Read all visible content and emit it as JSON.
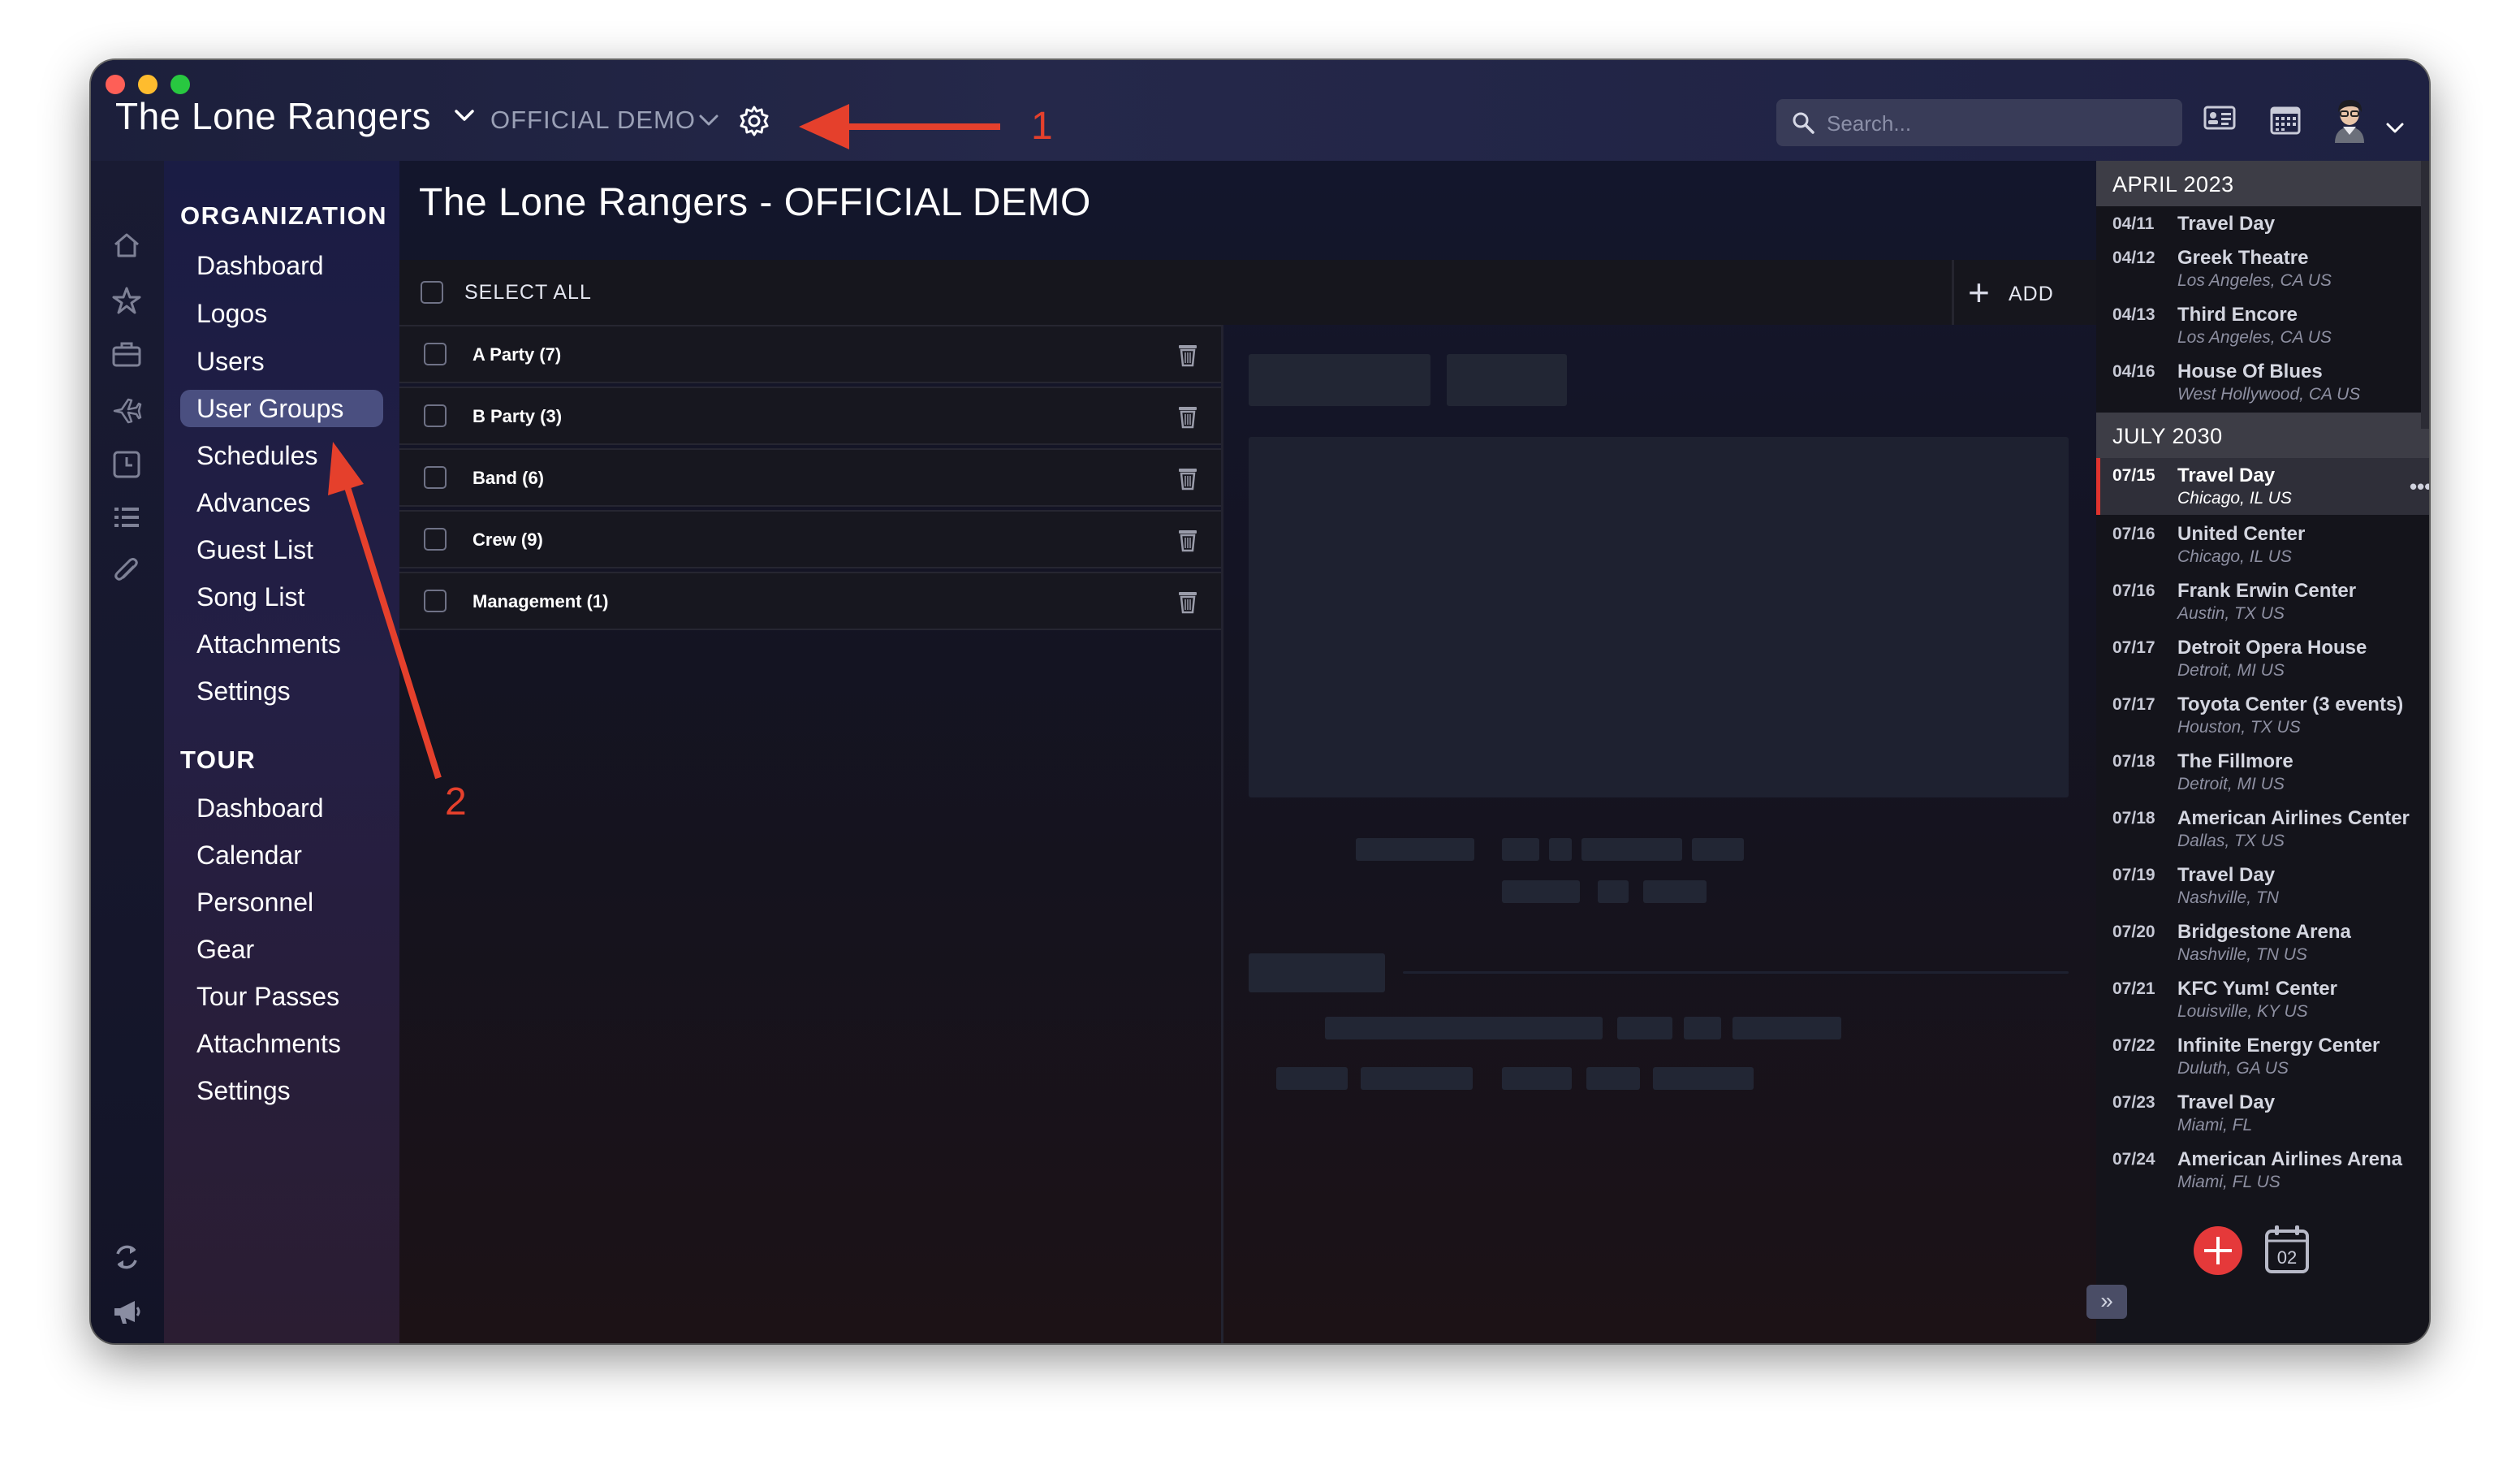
{
  "header": {
    "org_name": "The Lone Rangers",
    "org_sub": "OFFICIAL DEMO",
    "search_placeholder": "Search..."
  },
  "icons": {
    "rail": [
      "home-icon",
      "star-icon",
      "briefcase-icon",
      "plane-icon",
      "clock-icon",
      "list-icon",
      "paperclip-icon"
    ],
    "rail_bottom": [
      "sync-icon",
      "megaphone-icon"
    ]
  },
  "sidebar": {
    "org_title": "ORGANIZATION",
    "org_items": [
      {
        "label": "Dashboard"
      },
      {
        "label": "Logos"
      },
      {
        "label": "Users"
      },
      {
        "label": "User Groups",
        "active": true
      },
      {
        "label": "Schedules"
      },
      {
        "label": "Advances"
      },
      {
        "label": "Guest List"
      },
      {
        "label": "Song List"
      },
      {
        "label": "Attachments"
      },
      {
        "label": "Settings"
      }
    ],
    "tour_title": "TOUR",
    "tour_items": [
      {
        "label": "Dashboard"
      },
      {
        "label": "Calendar"
      },
      {
        "label": "Personnel"
      },
      {
        "label": "Gear"
      },
      {
        "label": "Tour Passes"
      },
      {
        "label": "Attachments"
      },
      {
        "label": "Settings"
      }
    ]
  },
  "main": {
    "title": "The Lone Rangers - OFFICIAL DEMO",
    "select_all": "SELECT ALL",
    "add_label": "ADD",
    "groups": [
      {
        "name": "A Party (7)"
      },
      {
        "name": "B Party (3)"
      },
      {
        "name": "Band (6)"
      },
      {
        "name": "Crew (9)"
      },
      {
        "name": "Management (1)"
      }
    ]
  },
  "schedule": {
    "months": [
      {
        "label": "APRIL 2023",
        "events": [
          {
            "date": "04/11",
            "title": "Travel Day",
            "location": ""
          },
          {
            "date": "04/12",
            "title": "Greek Theatre",
            "location": "Los Angeles, CA US"
          },
          {
            "date": "04/13",
            "title": "Third Encore",
            "location": "Los Angeles, CA US"
          },
          {
            "date": "04/16",
            "title": "House Of Blues",
            "location": "West Hollywood, CA US"
          }
        ]
      },
      {
        "label": "JULY 2030",
        "events": [
          {
            "date": "07/15",
            "title": "Travel Day",
            "location": "Chicago, IL US",
            "selected": true,
            "more": "•••"
          },
          {
            "date": "07/16",
            "title": "United Center",
            "location": "Chicago, IL US"
          },
          {
            "date": "07/16",
            "title": "Frank Erwin Center",
            "location": "Austin, TX US"
          },
          {
            "date": "07/17",
            "title": "Detroit Opera House",
            "location": "Detroit, MI US"
          },
          {
            "date": "07/17",
            "title": "Toyota Center (3 events)",
            "location": "Houston, TX US"
          },
          {
            "date": "07/18",
            "title": "The Fillmore",
            "location": "Detroit, MI US"
          },
          {
            "date": "07/18",
            "title": "American Airlines Center",
            "location": "Dallas, TX US"
          },
          {
            "date": "07/19",
            "title": "Travel Day",
            "location": "Nashville, TN"
          },
          {
            "date": "07/20",
            "title": "Bridgestone Arena",
            "location": "Nashville, TN US"
          },
          {
            "date": "07/21",
            "title": "KFC Yum! Center",
            "location": "Louisville, KY US"
          },
          {
            "date": "07/22",
            "title": "Infinite Energy Center",
            "location": "Duluth, GA US"
          },
          {
            "date": "07/23",
            "title": "Travel Day",
            "location": "Miami, FL"
          },
          {
            "date": "07/24",
            "title": "American Airlines Arena",
            "location": "Miami, FL US"
          }
        ]
      }
    ],
    "calendar_day": "02"
  },
  "annotations": {
    "label_1": "1",
    "label_2": "2",
    "color": "#e5402c"
  },
  "colors": {
    "accent_red": "#e5393a",
    "active_nav": "#4a4f80"
  }
}
